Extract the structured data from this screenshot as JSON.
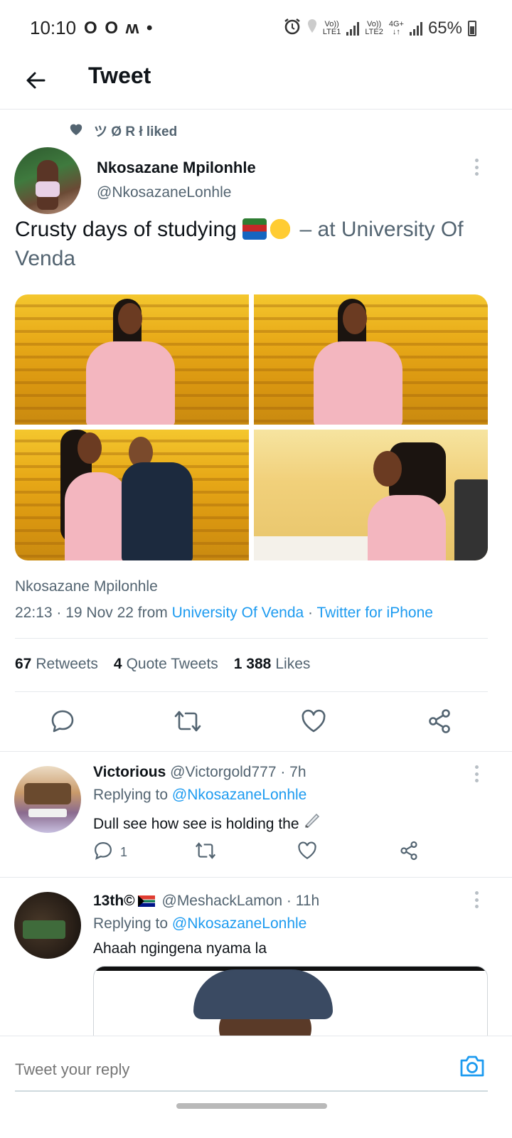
{
  "status_bar": {
    "time": "10:10",
    "left_icons": "O O ʍ •",
    "sim1_label_top": "Vo))",
    "sim1_label_bottom": "LTE1",
    "sim2_label_top": "Vo))",
    "sim2_label_bottom": "LTE2",
    "network": "4G+",
    "battery_percent": "65%"
  },
  "header": {
    "title": "Tweet",
    "back_icon": "arrow-left-icon"
  },
  "social_context": {
    "icon": "heart-filled-icon",
    "text": "ツ Ø R ł liked"
  },
  "tweet": {
    "author_name": "Nkosazane Mpilonhle",
    "author_handle": "@NkosazaneLonhle",
    "text": "Crusty days of studying",
    "emojis": [
      "books-emoji",
      "loudly-crying-face-emoji"
    ],
    "location_text": "– at University Of Venda",
    "media_count": 4,
    "meta_name": "Nkosazane Mpilonhle",
    "timestamp": "22:13 · 19 Nov 22 from ",
    "place_link": "University Of Venda",
    "separator": " · ",
    "client_link": "Twitter for iPhone",
    "stats": {
      "retweets_count": "67",
      "retweets_label": "Retweets",
      "quotes_count": "4",
      "quotes_label": "Quote Tweets",
      "likes_count": "1 388",
      "likes_label": "Likes"
    }
  },
  "replies": [
    {
      "name": "Victorious",
      "handle_time": "@Victorgold777 · 7h",
      "replying_prefix": "Replying to ",
      "replying_to": "@NkosazaneLonhle",
      "text": "Dull see how see is holding the",
      "trailing_emoji": "pen-emoji",
      "reply_count": "1"
    },
    {
      "name": "13th©",
      "flag": "south-africa-flag",
      "handle_time": "@MeshackLamon · 11h",
      "replying_prefix": "Replying to ",
      "replying_to": "@NkosazaneLonhle",
      "text": "Ahaah ngingena nyama la"
    }
  ],
  "composer": {
    "placeholder": "Tweet your reply",
    "camera_icon": "camera-icon"
  },
  "colors": {
    "link_blue": "#1d9bf0",
    "text_primary": "#0f1419",
    "text_secondary": "#536471",
    "divider": "#e6e9ec"
  }
}
